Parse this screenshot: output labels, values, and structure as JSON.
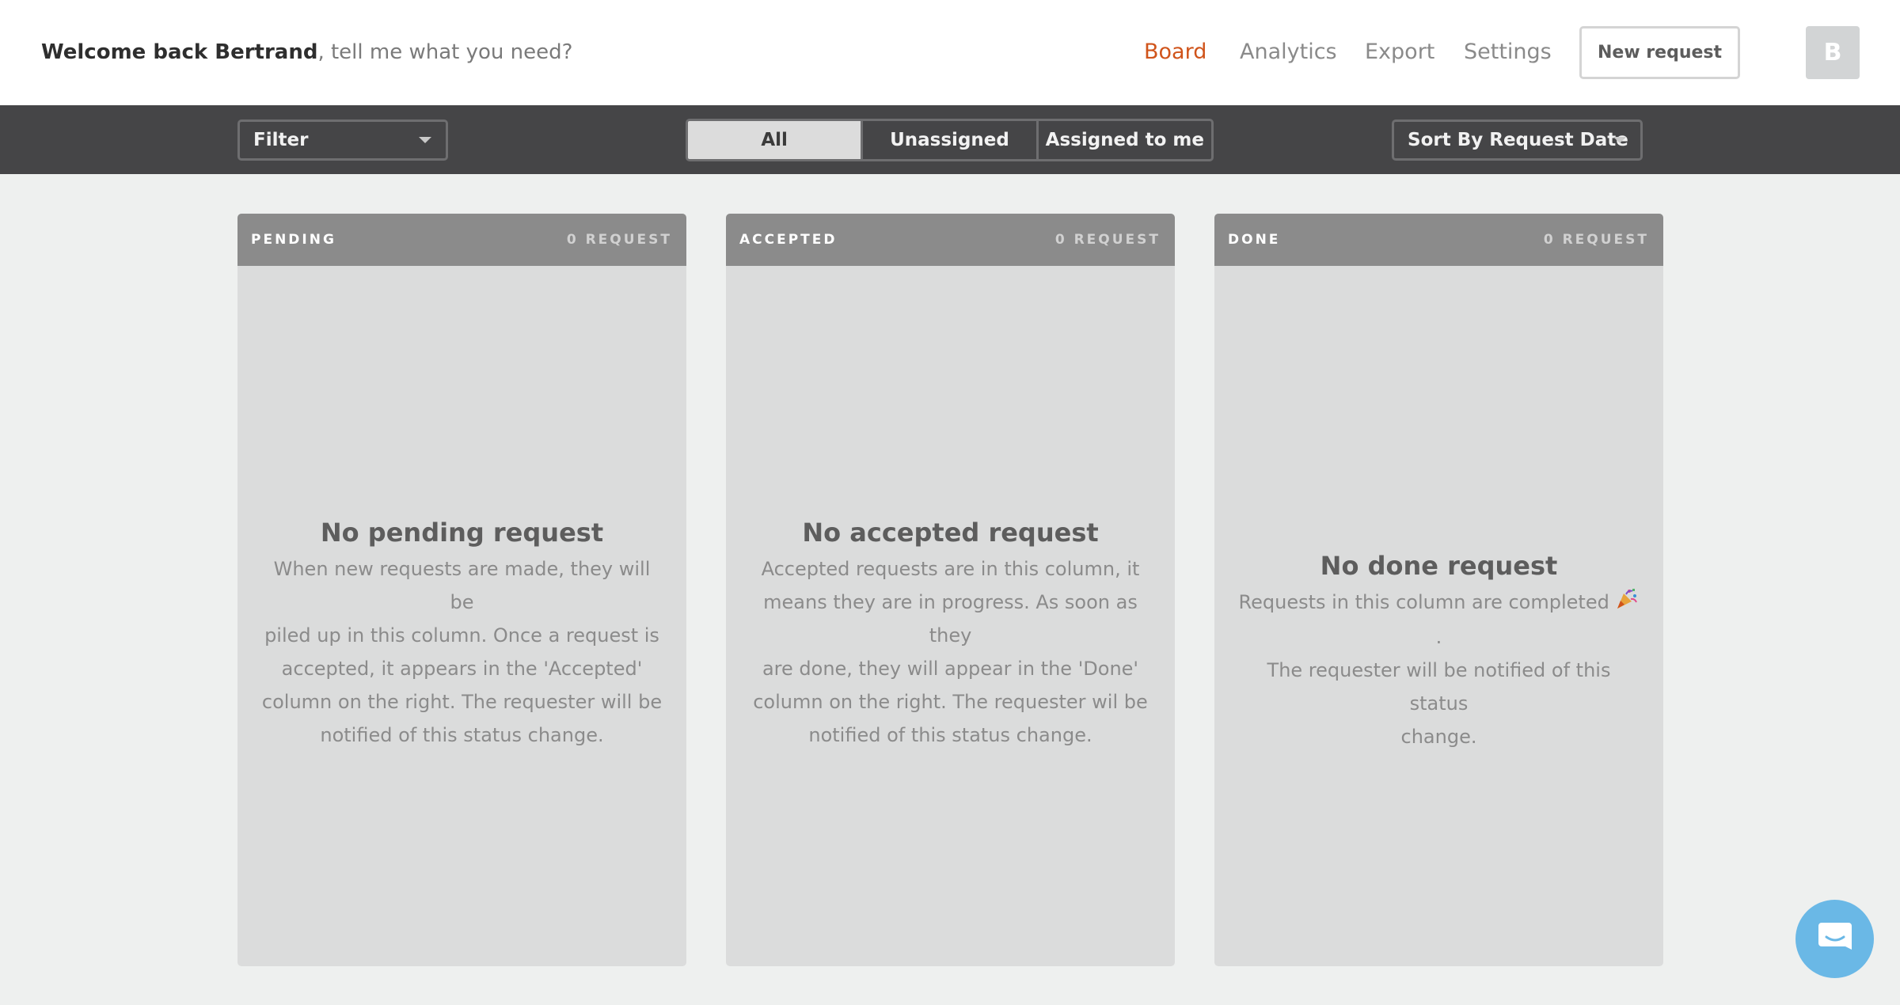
{
  "header": {
    "welcome_bold": "Welcome back Bertrand",
    "welcome_rest": ", tell me what you need?",
    "nav": {
      "board": "Board",
      "analytics": "Analytics",
      "export": "Export",
      "settings": "Settings"
    },
    "new_request_label": "New request",
    "avatar_initial": "B"
  },
  "toolbar": {
    "filter_label": "Filter",
    "segments": [
      "All",
      "Unassigned",
      "Assigned to me"
    ],
    "active_segment": "All",
    "sort_label": "Sort By Request Date"
  },
  "columns": [
    {
      "title": "PENDING",
      "count": "0 REQUEST",
      "empty_title": "No pending request",
      "empty_lines": [
        "When new requests are made, they will be",
        "piled up in this column. Once a request is",
        "accepted, it appears in the 'Accepted'",
        "column on the right. The requester will be",
        "notified of this status change."
      ]
    },
    {
      "title": "ACCEPTED",
      "count": "0 REQUEST",
      "empty_title": "No accepted request",
      "empty_lines": [
        "Accepted requests are in this column, it",
        "means they are in progress. As soon as they",
        "are done, they will appear in the 'Done'",
        "column on the right. The requester wil be",
        "notified of this status change."
      ]
    },
    {
      "title": "DONE",
      "count": "0 REQUEST",
      "empty_title": "No done request",
      "empty_line1": "Requests in this column are completed",
      "empty_line1_end": ".",
      "empty_lines_rest": [
        "The requester will be notified of this status",
        "change."
      ],
      "emoji_icon": "party-popper-icon"
    }
  ],
  "colors": {
    "accent": "#d0541b",
    "toolbar_bg": "#454547",
    "column_head": "#8b8b8b",
    "column_body": "#dbdcdc",
    "chat_button": "#6ab8e6"
  },
  "chat_icon": "chat-bubble-icon"
}
